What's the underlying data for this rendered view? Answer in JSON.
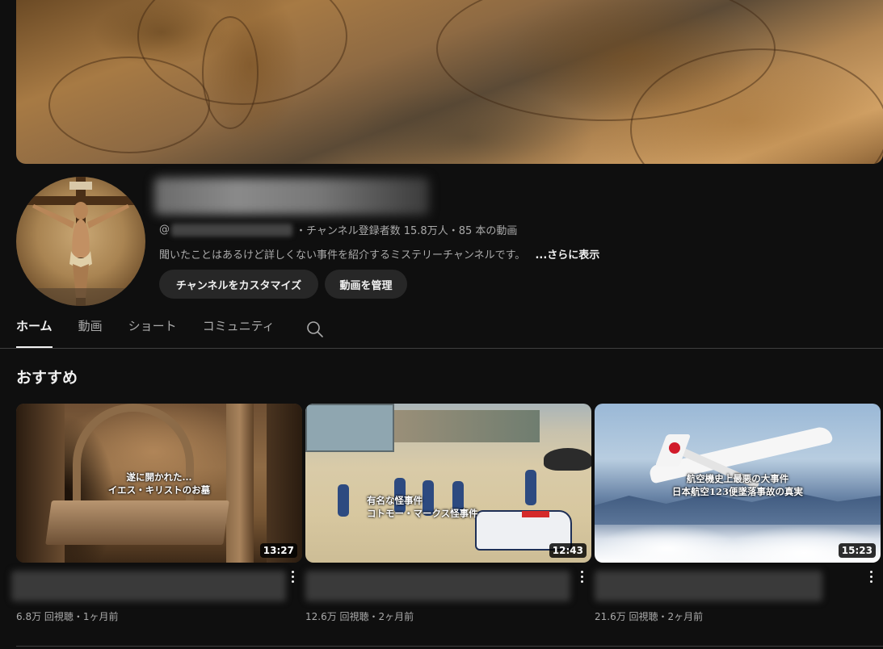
{
  "channel": {
    "handle_prefix": "@",
    "subscribers": "・チャンネル登録者数 15.8万人・85 本の動画",
    "description": "聞いたことはあるけど詳しくない事件を紹介するミステリーチャンネルです。",
    "more_label": "...さらに表示",
    "customize_label": "チャンネルをカスタマイズ",
    "manage_label": "動画を管理"
  },
  "tabs": [
    {
      "label": "ホーム",
      "active": true
    },
    {
      "label": "動画",
      "active": false
    },
    {
      "label": "ショート",
      "active": false
    },
    {
      "label": "コミュニティ",
      "active": false
    }
  ],
  "tab_search_icon": "search-icon",
  "section_title": "おすすめ",
  "videos": [
    {
      "caption_line1": "遂に開かれた...",
      "caption_line2": "イエス・キリストのお墓",
      "duration": "13:27",
      "meta": "6.8万 回視聴・1ヶ月前"
    },
    {
      "caption_line1": "有名な怪事件",
      "caption_line2": "コトモー・マークス怪事件",
      "duration": "12:43",
      "meta": "12.6万 回視聴・2ヶ月前"
    },
    {
      "caption_line1": "航空機史上最悪の大事件",
      "caption_line2": "日本航空123便墜落事故の真実",
      "duration": "15:23",
      "meta": "21.6万 回視聴・2ヶ月前"
    }
  ],
  "colors": {
    "background": "#0f0f0f",
    "button_bg": "#272727",
    "text_primary": "#f1f1f1",
    "text_secondary": "#aaaaaa"
  }
}
